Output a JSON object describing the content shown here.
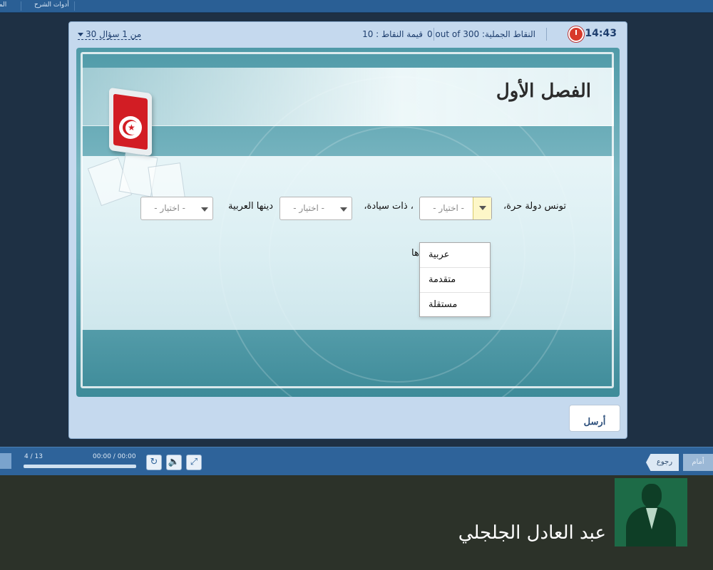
{
  "topbar": {
    "tools_label": "أدوات الشرح",
    "partial_label": "الم"
  },
  "quiz_header": {
    "timer": "14:43",
    "total_points": "0 out of 300 :النقاط الجملية",
    "points_value": "10 : قيمة النقاط",
    "question_nav": "30 من 1 سؤال"
  },
  "slide": {
    "title": "الفصل الأول",
    "sentence_part1": "تونس دولة حرة،",
    "sentence_part2": "، ذات سيادة،",
    "sentence_part3": "دينها العربية",
    "sentence_trail": "ها",
    "select_placeholder": "- اختيار -",
    "dropdown_options": [
      "عربية",
      "متقدمة",
      "مستقلة"
    ]
  },
  "submit_label": "أرسل",
  "playbar": {
    "slide_counter": "4 / 13",
    "time": "00:00 / 00:00",
    "back_label": "رجوع",
    "next_label": "أمام",
    "progress_fraction": 0.0
  },
  "footer": {
    "author_name": "عبد العادل الجلجلي"
  },
  "colors": {
    "accent": "#2e639a",
    "timer_red": "#d83a2b",
    "footer_bg": "#2c3229",
    "photo_bg": "#1d6b47"
  },
  "icons": [
    "timer-icon",
    "chevron-down-icon",
    "tunisia-flag-monitor",
    "replay-icon",
    "volume-icon",
    "fullscreen-icon"
  ]
}
